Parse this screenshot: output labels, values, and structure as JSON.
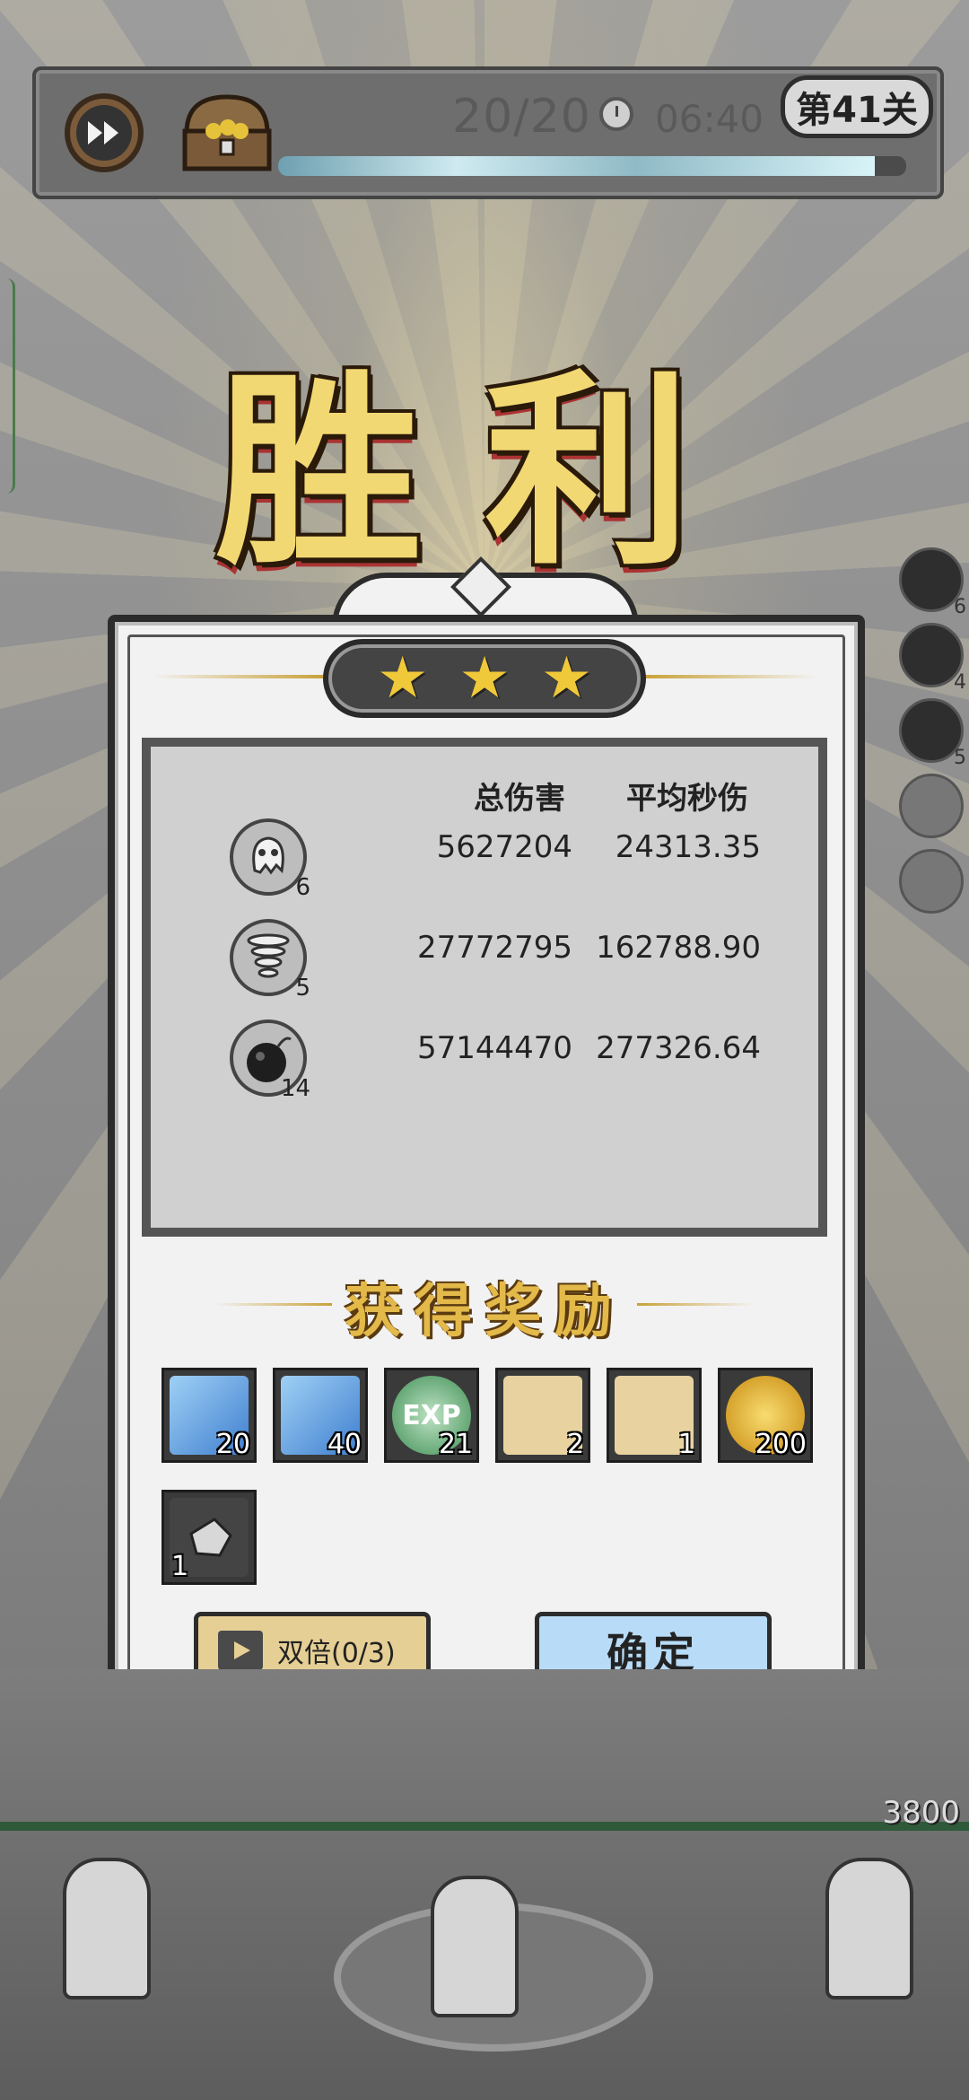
{
  "top_bar": {
    "wave": "20/20",
    "timer": "06:40",
    "level": "第41关",
    "wave_progress_fraction": 0.95
  },
  "victory_title": "胜利",
  "stars": {
    "earned": 3,
    "total": 3
  },
  "stats": {
    "headers": {
      "total_damage": "总伤害",
      "avg_dps": "平均秒伤"
    },
    "rows": [
      {
        "icon": "ghost-skill-icon",
        "level": "6",
        "total_damage": "5627204",
        "avg_dps": "24313.35"
      },
      {
        "icon": "tornado-skill-icon",
        "level": "5",
        "total_damage": "27772795",
        "avg_dps": "162788.90"
      },
      {
        "icon": "bomb-skill-icon",
        "level": "14",
        "total_damage": "57144470",
        "avg_dps": "277326.64"
      }
    ]
  },
  "rewards": {
    "title": "获得奖励",
    "items": [
      {
        "icon": "blue-crystal-card-icon",
        "qty": "20",
        "color": "#4a8fd6"
      },
      {
        "icon": "blue-crystal-card-icon",
        "qty": "40",
        "color": "#4a8fd6"
      },
      {
        "icon": "exp-orb-icon",
        "qty": "21",
        "color": "#3f8f55"
      },
      {
        "icon": "scroll-helmet-icon",
        "qty": "2",
        "color": "#e8d2a0"
      },
      {
        "icon": "scroll-armor-icon",
        "qty": "1",
        "color": "#e8d2a0"
      },
      {
        "icon": "gold-coin-icon",
        "qty": "200",
        "color": "#e0a820"
      },
      {
        "icon": "ore-stone-icon",
        "qty": "1",
        "color": "#9a9a9a"
      }
    ]
  },
  "buttons": {
    "double": "双倍(0/3)",
    "confirm": "确定"
  },
  "side_skills": [
    {
      "label": "6"
    },
    {
      "label": "4"
    },
    {
      "label": "5"
    },
    {
      "label": ""
    },
    {
      "label": ""
    }
  ],
  "base_hp": "3800"
}
